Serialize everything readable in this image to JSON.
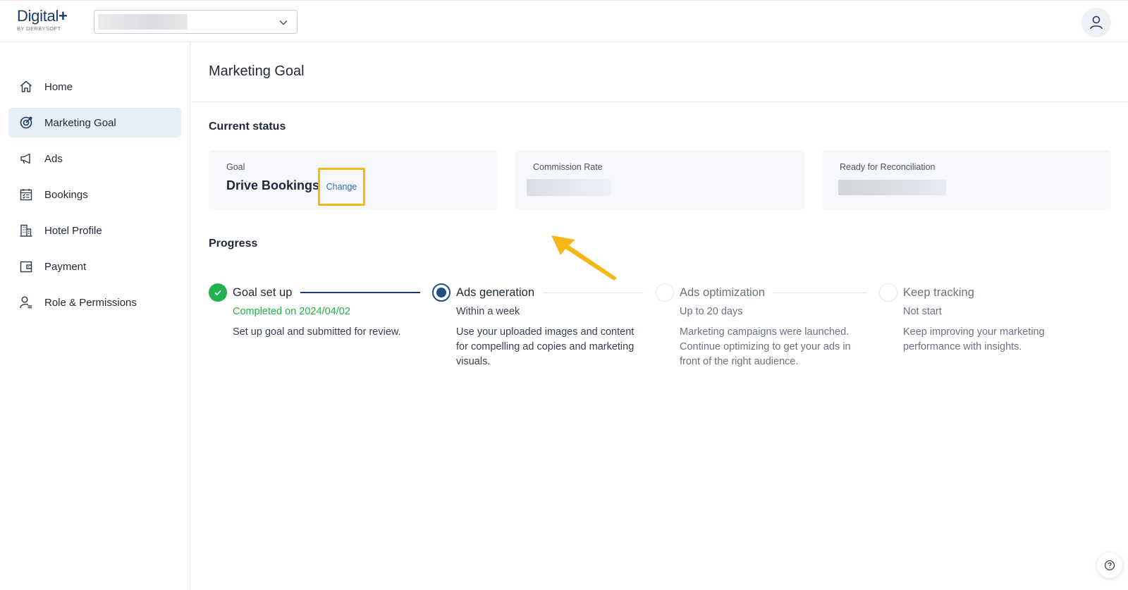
{
  "header": {
    "logo_main": "Digital",
    "logo_plus": "+",
    "logo_sub": "BY DERBYSOFT"
  },
  "sidebar": {
    "items": [
      {
        "label": "Home",
        "icon": "home-icon",
        "active": false
      },
      {
        "label": "Marketing Goal",
        "icon": "target-icon",
        "active": true
      },
      {
        "label": "Ads",
        "icon": "megaphone-icon",
        "active": false
      },
      {
        "label": "Bookings",
        "icon": "calendar-icon",
        "active": false
      },
      {
        "label": "Hotel Profile",
        "icon": "building-icon",
        "active": false
      },
      {
        "label": "Payment",
        "icon": "wallet-icon",
        "active": false
      },
      {
        "label": "Role & Permissions",
        "icon": "user-role-icon",
        "active": false
      }
    ]
  },
  "main": {
    "page_title": "Marketing Goal",
    "current_status": {
      "title": "Current status",
      "goal_label": "Goal",
      "goal_value": "Drive Bookings",
      "change_label": "Change",
      "commission_label": "Commission Rate",
      "reconciliation_label": "Ready for Reconciliation"
    },
    "progress": {
      "title": "Progress",
      "steps": [
        {
          "title": "Goal set up",
          "sub": "Completed on 2024/04/02",
          "desc": "Set up goal and submitted for review.",
          "state": "done"
        },
        {
          "title": "Ads generation",
          "sub": "Within a week",
          "desc": "Use your uploaded images and content for compelling ad copies and marketing visuals.",
          "state": "current"
        },
        {
          "title": "Ads optimization",
          "sub": "Up to 20 days",
          "desc": "Marketing campaigns were launched. Continue optimizing to get your ads in front of the right audience.",
          "state": "todo"
        },
        {
          "title": "Keep tracking",
          "sub": "Not start",
          "desc": "Keep improving your marketing performance with insights.",
          "state": "todo"
        }
      ]
    }
  },
  "colors": {
    "brand": "#1e3a6d",
    "active_nav": "#e7eef6",
    "success": "#22b14c",
    "link": "#2f6ec4",
    "highlight": "#f6b719"
  }
}
